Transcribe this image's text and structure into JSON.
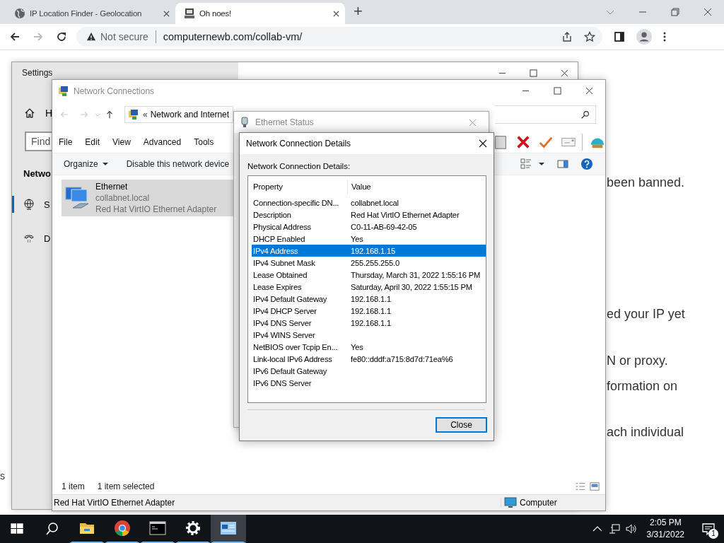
{
  "browser": {
    "tabs": [
      {
        "title": "IP Location Finder - Geolocation",
        "selected": false
      },
      {
        "title": "Oh noes!",
        "selected": true
      }
    ],
    "new_tab": "+",
    "security": "Not secure",
    "url": "computernewb.com/collab-vm/"
  },
  "page": {
    "fragments": [
      "been banned.",
      "ed your IP yet",
      "N or proxy.",
      "formation on",
      "ach individual"
    ],
    "left_fragment": "s"
  },
  "settings_window": {
    "title": "Settings",
    "home_label": "H",
    "search_placeholder": "Find",
    "section": "Netwo",
    "nav": [
      {
        "label": "S",
        "selected": true
      },
      {
        "label": "D",
        "selected": false
      }
    ]
  },
  "explorer": {
    "title": "Network Connections",
    "breadcrumb_prefix": "«",
    "breadcrumb": "Network and Internet",
    "menu": [
      "File",
      "Edit",
      "View",
      "Advanced",
      "Tools"
    ],
    "commands": [
      {
        "label": "Organize",
        "kind": "dropdown"
      },
      {
        "label": "Disable this network device",
        "kind": "button"
      }
    ],
    "items": [
      {
        "name": "Ethernet",
        "network": "collabnet.local",
        "device": "Red Hat VirtIO Ethernet Adapter",
        "selected": true
      }
    ],
    "item_count": "1 item",
    "selection_count": "1 item selected",
    "status_text": "Red Hat VirtIO Ethernet Adapter",
    "location": "Computer"
  },
  "status_window": {
    "title": "Ethernet Status"
  },
  "details_dialog": {
    "title": "Network Connection Details",
    "label": "Network Connection Details:",
    "columns": [
      "Property",
      "Value"
    ],
    "rows": [
      {
        "property": "Connection-specific DN...",
        "value": "collabnet.local",
        "selected": false
      },
      {
        "property": "Description",
        "value": "Red Hat VirtIO Ethernet Adapter",
        "selected": false
      },
      {
        "property": "Physical Address",
        "value": "C0-11-AB-69-42-05",
        "selected": false
      },
      {
        "property": "DHCP Enabled",
        "value": "Yes",
        "selected": false
      },
      {
        "property": "IPv4 Address",
        "value": "192.168.1.15",
        "selected": true
      },
      {
        "property": "IPv4 Subnet Mask",
        "value": "255.255.255.0",
        "selected": false
      },
      {
        "property": "Lease Obtained",
        "value": "Thursday, March 31, 2022 1:55:16 PM",
        "selected": false
      },
      {
        "property": "Lease Expires",
        "value": "Saturday, April 30, 2022 1:55:15 PM",
        "selected": false
      },
      {
        "property": "IPv4 Default Gateway",
        "value": "192.168.1.1",
        "selected": false
      },
      {
        "property": "IPv4 DHCP Server",
        "value": "192.168.1.1",
        "selected": false
      },
      {
        "property": "IPv4 DNS Server",
        "value": "192.168.1.1",
        "selected": false
      },
      {
        "property": "IPv4 WINS Server",
        "selected": false
      },
      {
        "property": "NetBIOS over Tcpip En...",
        "value": "Yes",
        "selected": false
      },
      {
        "property": "Link-local IPv6 Address",
        "value": "fe80::dddf:a715:8d7d:71ea%6",
        "selected": false
      },
      {
        "property": "IPv6 Default Gateway",
        "selected": false
      },
      {
        "property": "IPv6 DNS Server",
        "selected": false
      }
    ],
    "close_button": "Close"
  },
  "taskbar": {
    "apps": [
      {
        "kind": "explorer",
        "running": true,
        "selected": false
      },
      {
        "kind": "chrome",
        "running": true,
        "selected": false
      },
      {
        "kind": "terminal",
        "running": true,
        "selected": false
      },
      {
        "kind": "settings",
        "running": true,
        "selected": false
      },
      {
        "kind": "network",
        "running": true,
        "selected": true
      }
    ],
    "time": "2:05 PM",
    "date": "3/31/2022",
    "notification_count": "1"
  }
}
